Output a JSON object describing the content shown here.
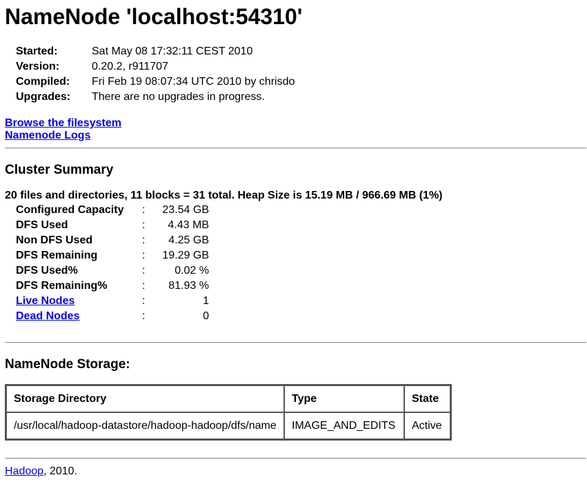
{
  "title": "NameNode 'localhost:54310'",
  "info": [
    {
      "label": "Started:",
      "value": "Sat May 08 17:32:11 CEST 2010"
    },
    {
      "label": "Version:",
      "value": "0.20.2, r911707"
    },
    {
      "label": "Compiled:",
      "value": "Fri Feb 19 08:07:34 UTC 2010 by chrisdo"
    },
    {
      "label": "Upgrades:",
      "value": "There are no upgrades in progress."
    }
  ],
  "links": {
    "browse": "Browse the filesystem",
    "logs": "Namenode Logs"
  },
  "cluster_summary": {
    "heading": "Cluster Summary",
    "summary_line": "20 files and directories, 11 blocks = 31 total. Heap Size is 15.19 MB / 966.69 MB (1%)",
    "separator": ":",
    "stats": [
      {
        "key": "Configured Capacity",
        "value": "23.54 GB"
      },
      {
        "key": "DFS Used",
        "value": "4.43 MB"
      },
      {
        "key": "Non DFS Used",
        "value": "4.25 GB"
      },
      {
        "key": "DFS Remaining",
        "value": "19.29 GB"
      },
      {
        "key": "DFS Used%",
        "value": "0.02 %"
      },
      {
        "key": "DFS Remaining%",
        "value": "81.93 %"
      },
      {
        "key": "Live Nodes",
        "value": "1"
      },
      {
        "key": "Dead Nodes",
        "value": "0"
      }
    ]
  },
  "storage": {
    "heading": "NameNode Storage:",
    "columns": [
      "Storage Directory",
      "Type",
      "State"
    ],
    "rows": [
      [
        "/usr/local/hadoop-datastore/hadoop-hadoop/dfs/name",
        "IMAGE_AND_EDITS",
        "Active"
      ]
    ]
  },
  "footer": {
    "link": "Hadoop",
    "text": ", 2010."
  },
  "colors": {
    "link": "#0000ee",
    "rule": "#9a9a9a",
    "table_border": "#555555"
  }
}
